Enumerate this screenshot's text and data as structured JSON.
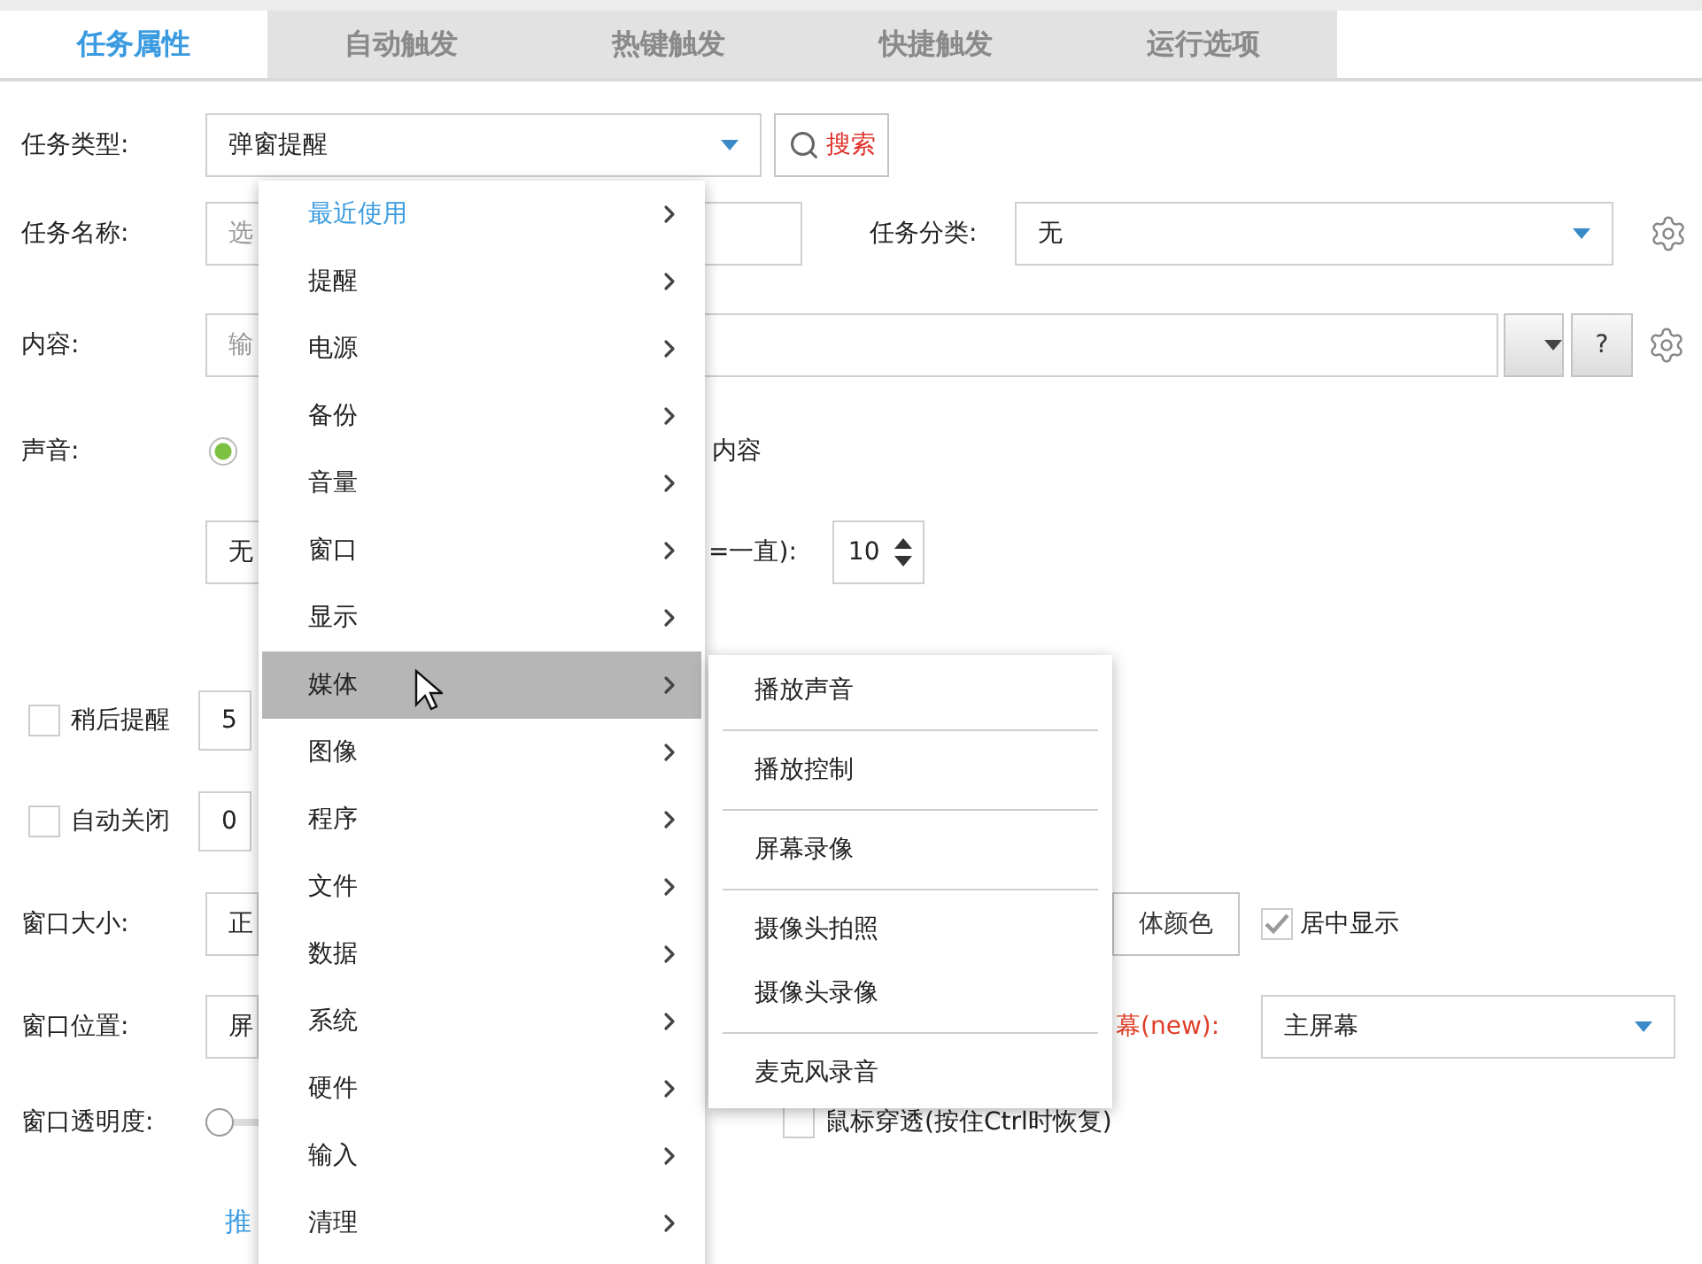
{
  "tabs": [
    {
      "label": "任务属性",
      "selected": true
    },
    {
      "label": "自动触发",
      "selected": false
    },
    {
      "label": "热键触发",
      "selected": false
    },
    {
      "label": "快捷触发",
      "selected": false
    },
    {
      "label": "运行选项",
      "selected": false
    }
  ],
  "form": {
    "task_type": {
      "label": "任务类型:",
      "value": "弹窗提醒"
    },
    "search_button": "搜索",
    "task_name": {
      "label": "任务名称:",
      "placeholder": "选"
    },
    "category": {
      "label": "任务分类:",
      "value": "无"
    },
    "content": {
      "label": "内容:",
      "placeholder": "输",
      "help_button": "?"
    },
    "sound": {
      "label": "声音:",
      "checked": true,
      "option_text": "内容"
    },
    "sound_file": {
      "value": "无"
    },
    "repeat": {
      "label": "=一直):",
      "value": "10"
    },
    "remind_later": {
      "label": "稍后提醒",
      "checked": false,
      "value": "5"
    },
    "auto_close": {
      "label": "自动关闭",
      "checked": false,
      "value": "0"
    },
    "window_size": {
      "label": "窗口大小:",
      "value": "正"
    },
    "font_color_button": "体颜色",
    "center": {
      "label": "居中显示",
      "checked": true
    },
    "window_position": {
      "label": "窗口位置:",
      "value": "屏"
    },
    "screen": {
      "label": "幕(new):",
      "value": "主屏幕"
    },
    "opacity": {
      "label": "窗口透明度:",
      "level": 0
    },
    "click_through": {
      "label": "鼠标穿透(按住Ctrl时恢复)",
      "checked": false
    },
    "link": "推"
  },
  "menu": {
    "items": [
      {
        "label": "最近使用",
        "kind": "recent",
        "selected": false
      },
      {
        "label": "提醒",
        "kind": "category",
        "selected": false
      },
      {
        "label": "电源",
        "kind": "category",
        "selected": false
      },
      {
        "label": "备份",
        "kind": "category",
        "selected": false
      },
      {
        "label": "音量",
        "kind": "category",
        "selected": false
      },
      {
        "label": "窗口",
        "kind": "category",
        "selected": false
      },
      {
        "label": "显示",
        "kind": "category",
        "selected": false
      },
      {
        "label": "媒体",
        "kind": "category",
        "selected": true
      },
      {
        "label": "图像",
        "kind": "category",
        "selected": false
      },
      {
        "label": "程序",
        "kind": "category",
        "selected": false
      },
      {
        "label": "文件",
        "kind": "category",
        "selected": false
      },
      {
        "label": "数据",
        "kind": "category",
        "selected": false
      },
      {
        "label": "系统",
        "kind": "category",
        "selected": false
      },
      {
        "label": "硬件",
        "kind": "category",
        "selected": false
      },
      {
        "label": "输入",
        "kind": "category",
        "selected": false
      },
      {
        "label": "清理",
        "kind": "category",
        "selected": false
      }
    ]
  },
  "submenu": {
    "groups": [
      [
        "播放声音"
      ],
      [
        "播放控制"
      ],
      [
        "屏幕录像"
      ],
      [
        "摄像头拍照",
        "摄像头录像"
      ],
      [
        "麦克风录音"
      ]
    ]
  }
}
